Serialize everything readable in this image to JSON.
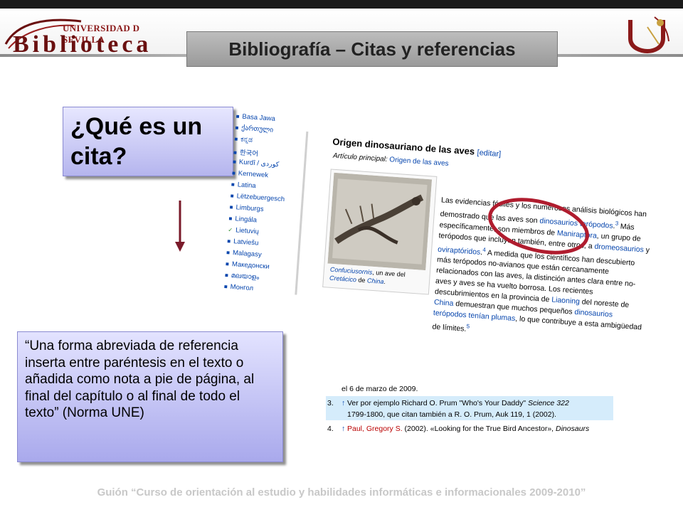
{
  "header": {
    "logo_top": "UNIVERSIDAD D SEVILLA",
    "logo_main": "Biblioteca",
    "title": "Bibliografía – Citas y referencias"
  },
  "question": "¿Qué es un cita?",
  "definition": "“Una forma abreviada de referencia inserta entre paréntesis en el texto o añadida como nota a pie de página, al final del capítulo o al final de todo el texto” (Norma UNE)",
  "wiki": {
    "languages": [
      "Basa Jawa",
      "ქართული",
      "ಕನ್ನಡ",
      "한국어",
      "Kurdî / كوردی",
      "Kernewek",
      "Latina",
      "Lëtzebuergesch",
      "Limburgs",
      "Lingála",
      "Lietuvių",
      "Latviešu",
      "Malagasy",
      "Македонски",
      "മലയാളം",
      "Монгол"
    ],
    "section_title": "Origen dinosauriano de las aves",
    "edit_link": "[editar]",
    "main_article_label": "Artículo principal:",
    "main_article_link": "Origen de las aves",
    "caption_link": "Confuciusornis",
    "caption_rest1": ", un ave del",
    "caption_link2": "Cretácico",
    "caption_rest2": " de ",
    "caption_link3": "China",
    "caption_end": ".",
    "p1": "Las evidencias fósiles y los numerosos análisis biológicos han demostrado que las aves son ",
    "p1_link": "dinosaurios terópodos",
    "p1_sup": "3",
    "p2": " Más específicamente, son miembros de ",
    "p2_link": "Maniraptora",
    "p3": ", un grupo de terópodos que incluyen también, entre otros, a ",
    "p3_link": "dromeosaurios",
    "p3_and": " y ",
    "p3_link2": "oviraptóridos",
    "p3_sup": "4",
    "p4": " A medida que los científicos han descubierto más terópodos no-avianos que están cercanamente relacionados con las aves, la distinción antes clara entre no-aves y aves se ha vuelto borrosa. Los recientes descubrimientos en la provincia de ",
    "p4_link": "Liaoning",
    "p5": " del noreste de ",
    "p5_link": "China",
    "p6": " demuestran que muchos pequeños ",
    "p6_link": "dinosaurios terópodos tenían plumas",
    "p7": ", lo que contribuye a esta ambigüedad de límites.",
    "p7_sup": "5"
  },
  "references": {
    "line0": "el 6 de marzo de 2009.",
    "ref3_num": "3.",
    "ref3_arrow": "↑",
    "ref3_text_a": "Ver por ejemplo Richard O. Prum \"Who's Your Daddy\"",
    "ref3_journal": "Science 322",
    "ref3_text_b": "1799-1800, que citan también a R. O. Prum, Auk 119, 1 (2002).",
    "ref4_num": "4.",
    "ref4_arrow": "↑",
    "ref4_link": "Paul, Gregory S.",
    "ref4_text": " (2002). «Looking for the True Bird Ancestor»,",
    "ref4_book": "Dinosaurs"
  },
  "footer": "Guión “Curso de orientación al estudio y habilidades informáticas e informacionales 2009-2010”",
  "colors": {
    "title_box": "#a9a9a9",
    "blue_box": "#b5b5ee",
    "arrow": "#7a1a2a",
    "ellipse": "#b01c2e",
    "link": "#0645ad"
  }
}
